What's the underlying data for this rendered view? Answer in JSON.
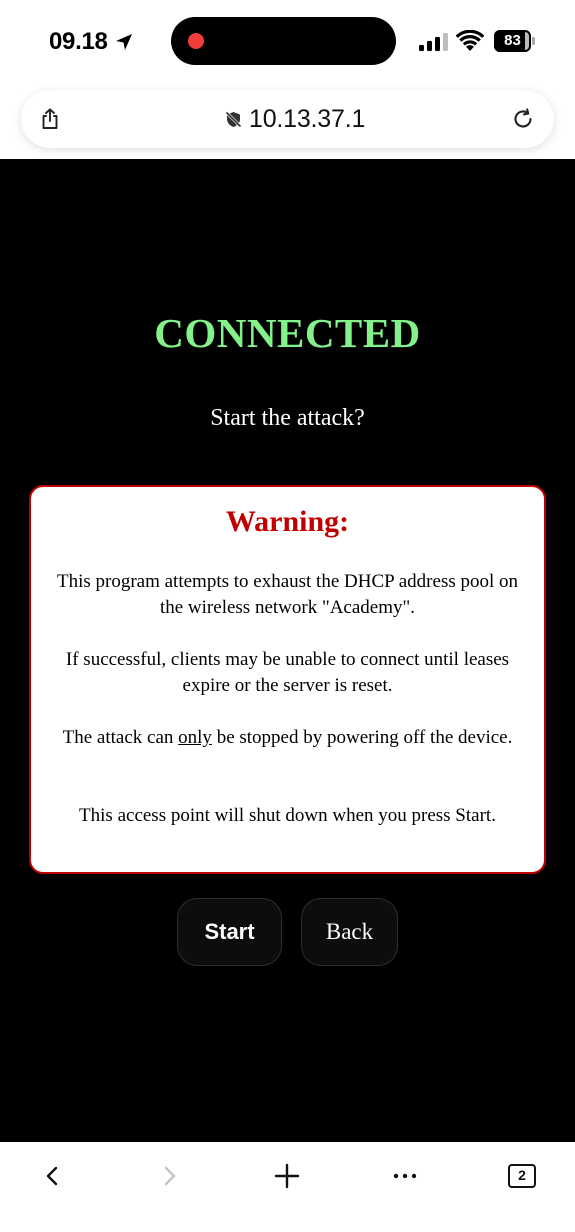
{
  "status_bar": {
    "time": "09.18",
    "battery_percent": "83",
    "battery_level": 0.83,
    "recording": true
  },
  "browser": {
    "url": "10.13.37.1",
    "tab_count": "2",
    "icons": {
      "share": "share-icon",
      "insecure": "not-secure-icon",
      "reload": "reload-icon",
      "back": "chevron-left-icon",
      "forward": "chevron-right-icon",
      "new_tab": "plus-icon",
      "more": "ellipsis-icon",
      "tabs": "tabs-icon"
    }
  },
  "page": {
    "heading": "CONNECTED",
    "subtitle": "Start the attack?",
    "warning": {
      "title": "Warning:",
      "paragraph1": "This program attempts to exhaust the DHCP address pool on the wireless network \"Academy\".",
      "paragraph2": "If successful, clients may be unable to connect until leases expire or the server is reset.",
      "paragraph3_before": "The attack can ",
      "paragraph3_emphasis": "only",
      "paragraph3_after": " be stopped by powering off the device.",
      "paragraph4": "This access point will shut down when you press Start."
    },
    "buttons": {
      "start": "Start",
      "back": "Back"
    }
  },
  "colors": {
    "background": "#000000",
    "heading": "#84f28a",
    "warning_accent": "#c00000",
    "recording_dot": "#f23d3a"
  }
}
